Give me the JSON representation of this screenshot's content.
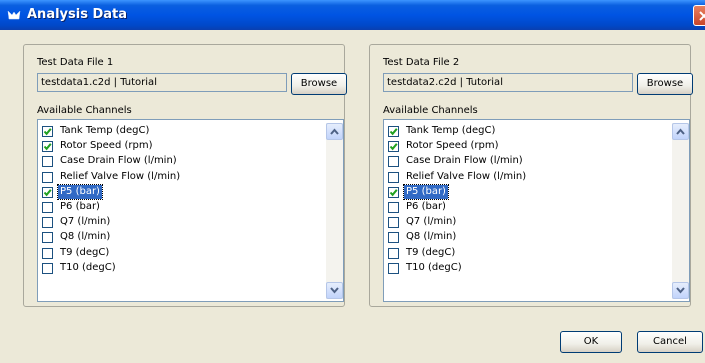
{
  "window": {
    "title": "Analysis Data"
  },
  "files": [
    {
      "heading": "Test Data File 1",
      "value": "testdata1.c2d | Tutorial",
      "browse_label": "Browse",
      "channels_label": "Available Channels",
      "channels": [
        {
          "label": "Tank Temp (degC)",
          "checked": true,
          "selected": false
        },
        {
          "label": "Rotor Speed (rpm)",
          "checked": true,
          "selected": false
        },
        {
          "label": "Case Drain Flow (l/min)",
          "checked": false,
          "selected": false
        },
        {
          "label": "Relief Valve Flow (l/min)",
          "checked": false,
          "selected": false
        },
        {
          "label": "P5 (bar)",
          "checked": true,
          "selected": true
        },
        {
          "label": "P6 (bar)",
          "checked": false,
          "selected": false
        },
        {
          "label": "Q7 (l/min)",
          "checked": false,
          "selected": false
        },
        {
          "label": "Q8 (l/min)",
          "checked": false,
          "selected": false
        },
        {
          "label": "T9 (degC)",
          "checked": false,
          "selected": false
        },
        {
          "label": "T10 (degC)",
          "checked": false,
          "selected": false
        }
      ]
    },
    {
      "heading": "Test Data File 2",
      "value": "testdata2.c2d | Tutorial",
      "browse_label": "Browse",
      "channels_label": "Available Channels",
      "channels": [
        {
          "label": "Tank Temp (degC)",
          "checked": true,
          "selected": false
        },
        {
          "label": "Rotor Speed (rpm)",
          "checked": true,
          "selected": false
        },
        {
          "label": "Case Drain Flow (l/min)",
          "checked": false,
          "selected": false
        },
        {
          "label": "Relief Valve Flow (l/min)",
          "checked": false,
          "selected": false
        },
        {
          "label": "P5 (bar)",
          "checked": true,
          "selected": true
        },
        {
          "label": "P6 (bar)",
          "checked": false,
          "selected": false
        },
        {
          "label": "Q7 (l/min)",
          "checked": false,
          "selected": false
        },
        {
          "label": "Q8 (l/min)",
          "checked": false,
          "selected": false
        },
        {
          "label": "T9 (degC)",
          "checked": false,
          "selected": false
        },
        {
          "label": "T10 (degC)",
          "checked": false,
          "selected": false
        }
      ]
    }
  ],
  "buttons": {
    "ok": "OK",
    "cancel": "Cancel"
  },
  "colors": {
    "titlebar": "#0054e3",
    "selection": "#316ac5",
    "check": "#21a121",
    "dialog_bg": "#ece9d8"
  }
}
